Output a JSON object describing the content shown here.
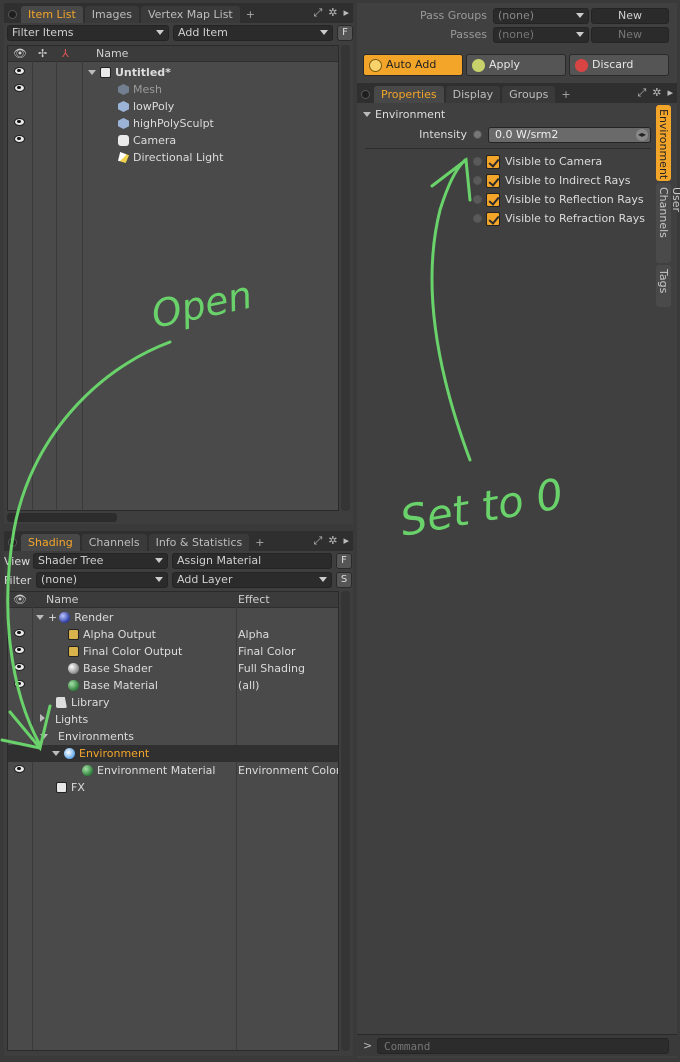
{
  "top_left": {
    "tabs": [
      "Item List",
      "Images",
      "Vertex Map List",
      "+"
    ],
    "filter_items": "Filter Items",
    "add_item": "Add Item",
    "f_btn": "F",
    "col_name": "Name",
    "items": [
      {
        "label": "Untitled*",
        "icon": "scene-icon",
        "visible": true
      },
      {
        "label": "Mesh",
        "icon": "mesh-icon",
        "visible": true,
        "dim": true
      },
      {
        "label": "lowPoly",
        "icon": "mesh-icon",
        "visible": false
      },
      {
        "label": "highPolySculpt",
        "icon": "mesh-icon",
        "visible": true
      },
      {
        "label": "Camera",
        "icon": "camera-icon",
        "visible": true
      },
      {
        "label": "Directional Light",
        "icon": "light-icon",
        "visible": false
      }
    ]
  },
  "shading": {
    "tabs": [
      "Shading",
      "Channels",
      "Info & Statistics",
      "+"
    ],
    "view_label": "View",
    "view_value": "Shader Tree",
    "assign_material": "Assign Material",
    "f_btn": "F",
    "filter_label": "Filter",
    "filter_value": "(none)",
    "add_layer": "Add Layer",
    "s_btn": "S",
    "col_name": "Name",
    "col_effect": "Effect",
    "rows": [
      {
        "label": "Render",
        "effect": ""
      },
      {
        "label": "Alpha Output",
        "effect": "Alpha"
      },
      {
        "label": "Final Color Output",
        "effect": "Final Color"
      },
      {
        "label": "Base Shader",
        "effect": "Full Shading"
      },
      {
        "label": "Base Material",
        "effect": "(all)"
      },
      {
        "label": "Library",
        "effect": ""
      },
      {
        "label": "Lights",
        "effect": ""
      },
      {
        "label": "Environments",
        "effect": ""
      },
      {
        "label": "Environment",
        "effect": ""
      },
      {
        "label": "Environment Material",
        "effect": "Environment Color"
      },
      {
        "label": "FX",
        "effect": ""
      }
    ]
  },
  "right": {
    "pass_groups_label": "Pass Groups",
    "pass_groups_value": "(none)",
    "passes_label": "Passes",
    "passes_value": "(none)",
    "new_label": "New",
    "auto_add": "Auto Add",
    "apply": "Apply",
    "discard": "Discard",
    "tabs": [
      "Properties",
      "Display",
      "Groups",
      "+"
    ],
    "section": "Environment",
    "intensity_label": "Intensity",
    "intensity_value": "0.0 W/srm2",
    "checks": [
      "Visible to Camera",
      "Visible to Indirect Rays",
      "Visible to Reflection Rays",
      "Visible to Refraction Rays"
    ],
    "side_tabs": [
      "Environment",
      "User Channels",
      "Tags"
    ],
    "command_placeholder": "Command",
    "prompt": ">"
  },
  "annotations": {
    "open": "Open",
    "set_to_zero": "Set to 0"
  }
}
